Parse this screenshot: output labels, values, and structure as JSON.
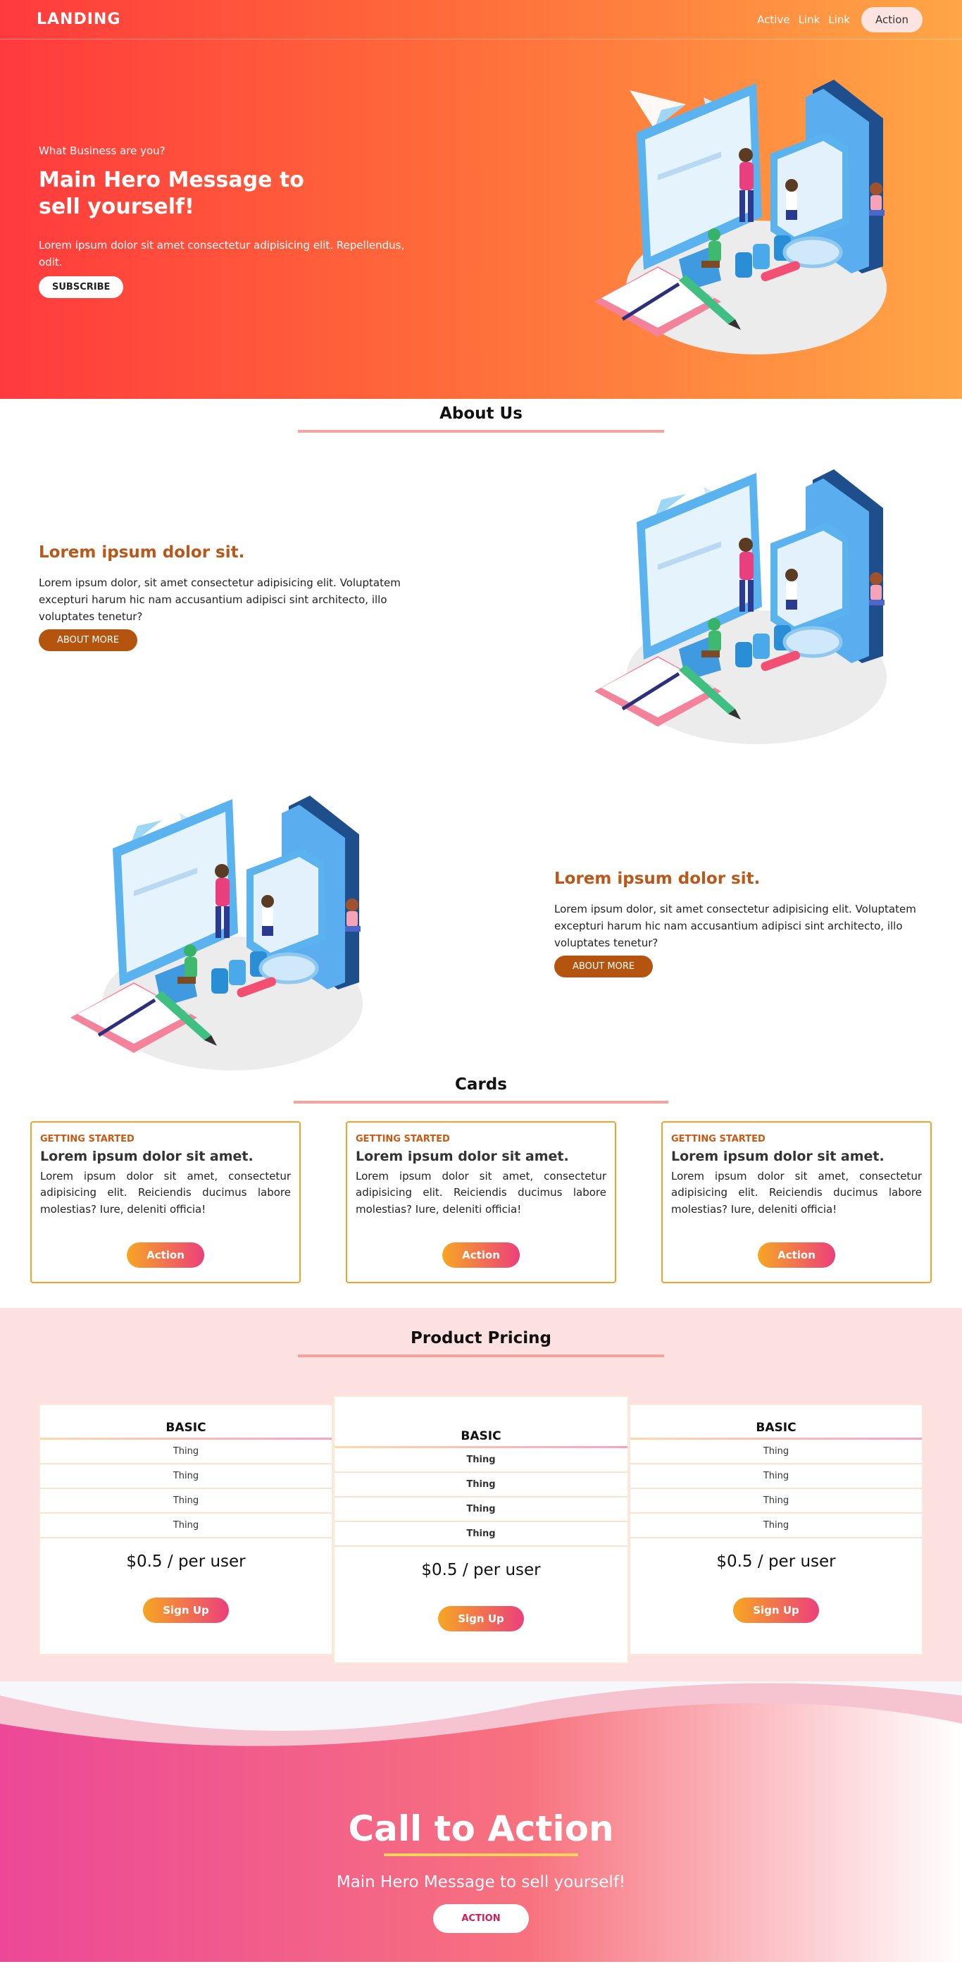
{
  "nav": {
    "brand": "LANDING",
    "links": [
      "Active",
      "Link",
      "Link"
    ],
    "action": "Action"
  },
  "hero": {
    "eyebrow": "What Business are you?",
    "title": "Main Hero Message to sell yourself!",
    "description": "Lorem ipsum dolor sit amet consectetur adipisicing elit. Repellendus, odit.",
    "button": "SUBSCRIBE"
  },
  "about": {
    "heading": "About Us",
    "features": [
      {
        "title": "Lorem ipsum dolor sit.",
        "description": "Lorem ipsum dolor, sit amet consectetur adipisicing elit. Voluptatem excepturi harum hic nam accusantium adipisci sint architecto, illo voluptates tenetur?",
        "button": "ABOUT MORE"
      },
      {
        "title": "Lorem ipsum dolor sit.",
        "description": "Lorem ipsum dolor, sit amet consectetur adipisicing elit. Voluptatem excepturi harum hic nam accusantium adipisci sint architecto, illo voluptates tenetur?",
        "button": "ABOUT MORE"
      }
    ]
  },
  "cards": {
    "heading": "Cards",
    "items": [
      {
        "eyebrow": "GETTING STARTED",
        "title": "Lorem ipsum dolor sit amet.",
        "description": "Lorem ipsum dolor sit amet, consectetur adipisicing elit. Reiciendis ducimus labore molestias? Iure, deleniti officia!",
        "button": "Action"
      },
      {
        "eyebrow": "GETTING STARTED",
        "title": "Lorem ipsum dolor sit amet.",
        "description": "Lorem ipsum dolor sit amet, consectetur adipisicing elit. Reiciendis ducimus labore molestias? Iure, deleniti officia!",
        "button": "Action"
      },
      {
        "eyebrow": "GETTING STARTED",
        "title": "Lorem ipsum dolor sit amet.",
        "description": "Lorem ipsum dolor sit amet, consectetur adipisicing elit. Reiciendis ducimus labore molestias? Iure, deleniti officia!",
        "button": "Action"
      }
    ]
  },
  "pricing": {
    "heading": "Product Pricing",
    "plans": [
      {
        "name": "BASIC",
        "rows": [
          "Thing",
          "Thing",
          "Thing",
          "Thing"
        ],
        "price": "$0.5 / per user",
        "button": "Sign Up"
      },
      {
        "name": "BASIC",
        "rows": [
          "Thing",
          "Thing",
          "Thing",
          "Thing"
        ],
        "price": "$0.5 / per user",
        "button": "Sign Up"
      },
      {
        "name": "BASIC",
        "rows": [
          "Thing",
          "Thing",
          "Thing",
          "Thing"
        ],
        "price": "$0.5 / per user",
        "button": "Sign Up"
      }
    ]
  },
  "cta": {
    "title": "Call to Action",
    "subtitle": "Main Hero Message to sell yourself!",
    "button": "ACTION"
  },
  "colors": {
    "hero_start": "#ff3a3d",
    "hero_end": "#ffa646",
    "feature_title": "#b8581a",
    "about_button": "#b4540f",
    "card_border": "#f0a42a",
    "pricing_bg": "#fde0e0",
    "button_gradient_start": "#f6a623",
    "button_gradient_end": "#ec407a",
    "cta_rule": "#ffd35c"
  }
}
